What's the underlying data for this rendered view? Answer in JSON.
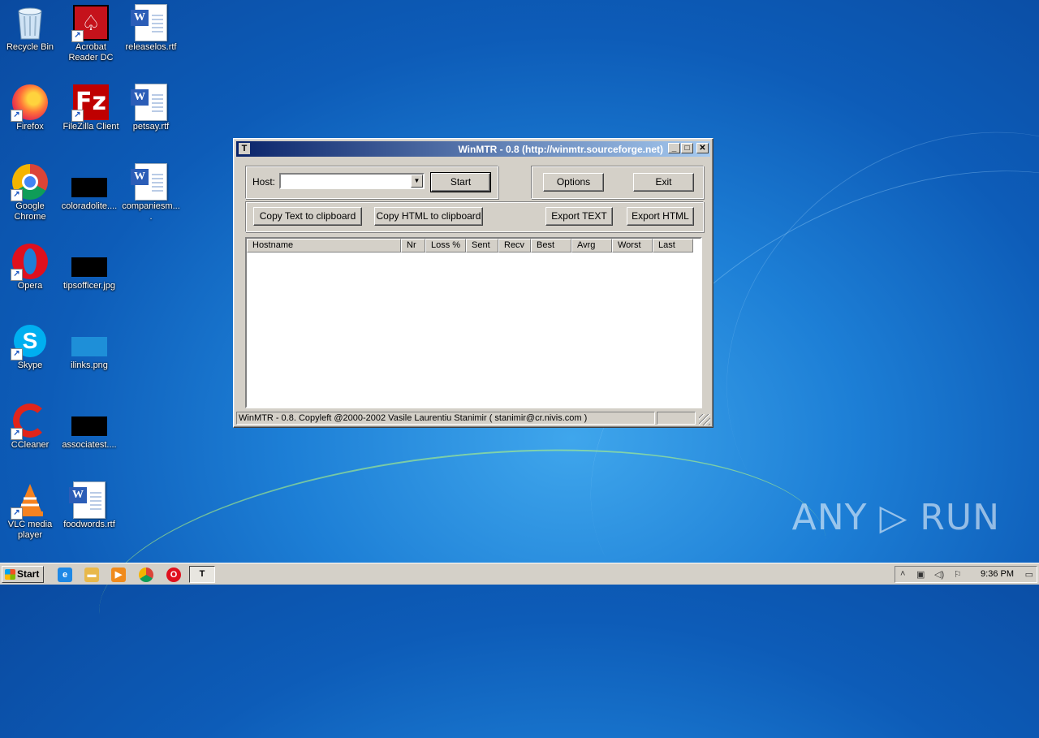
{
  "desktop": {
    "icons": [
      {
        "label": "Recycle Bin",
        "icon": "recycle-bin-icon"
      },
      {
        "label": "Acrobat Reader DC",
        "icon": "acrobat-icon"
      },
      {
        "label": "releaselos.rtf",
        "icon": "word-document-icon"
      },
      {
        "label": "Firefox",
        "icon": "firefox-icon"
      },
      {
        "label": "FileZilla Client",
        "icon": "filezilla-icon"
      },
      {
        "label": "petsay.rtf",
        "icon": "word-document-icon"
      },
      {
        "label": "Google Chrome",
        "icon": "chrome-icon"
      },
      {
        "label": "coloradolite....",
        "icon": "image-thumbnail-icon"
      },
      {
        "label": "companiesm....",
        "icon": "word-document-icon"
      },
      {
        "label": "Opera",
        "icon": "opera-icon"
      },
      {
        "label": "tipsofficer.jpg",
        "icon": "image-thumbnail-icon"
      },
      {
        "label": "Skype",
        "icon": "skype-icon"
      },
      {
        "label": "ilinks.png",
        "icon": "image-thumbnail-icon"
      },
      {
        "label": "CCleaner",
        "icon": "ccleaner-icon"
      },
      {
        "label": "associatest....",
        "icon": "image-thumbnail-icon"
      },
      {
        "label": "VLC media player",
        "icon": "vlc-icon"
      },
      {
        "label": "foodwords.rtf",
        "icon": "word-document-icon"
      }
    ],
    "watermark": "ANY ▷ RUN"
  },
  "window": {
    "title": "WinMTR - 0.8 (http://winmtr.sourceforge.net)",
    "host_label": "Host:",
    "host_value": "",
    "start_label": "Start",
    "options_label": "Options",
    "exit_label": "Exit",
    "copy_text_label": "Copy Text to clipboard",
    "copy_html_label": "Copy HTML to clipboard",
    "export_text_label": "Export TEXT",
    "export_html_label": "Export HTML",
    "columns": [
      "Hostname",
      "Nr",
      "Loss %",
      "Sent",
      "Recv",
      "Best",
      "Avrg",
      "Worst",
      "Last"
    ],
    "status": "WinMTR - 0.8. Copyleft @2000-2002 Vasile Laurentiu Stanimir  ( stanimir@cr.nivis.com )"
  },
  "taskbar": {
    "start_label": "Start",
    "clock": "9:36 PM"
  }
}
